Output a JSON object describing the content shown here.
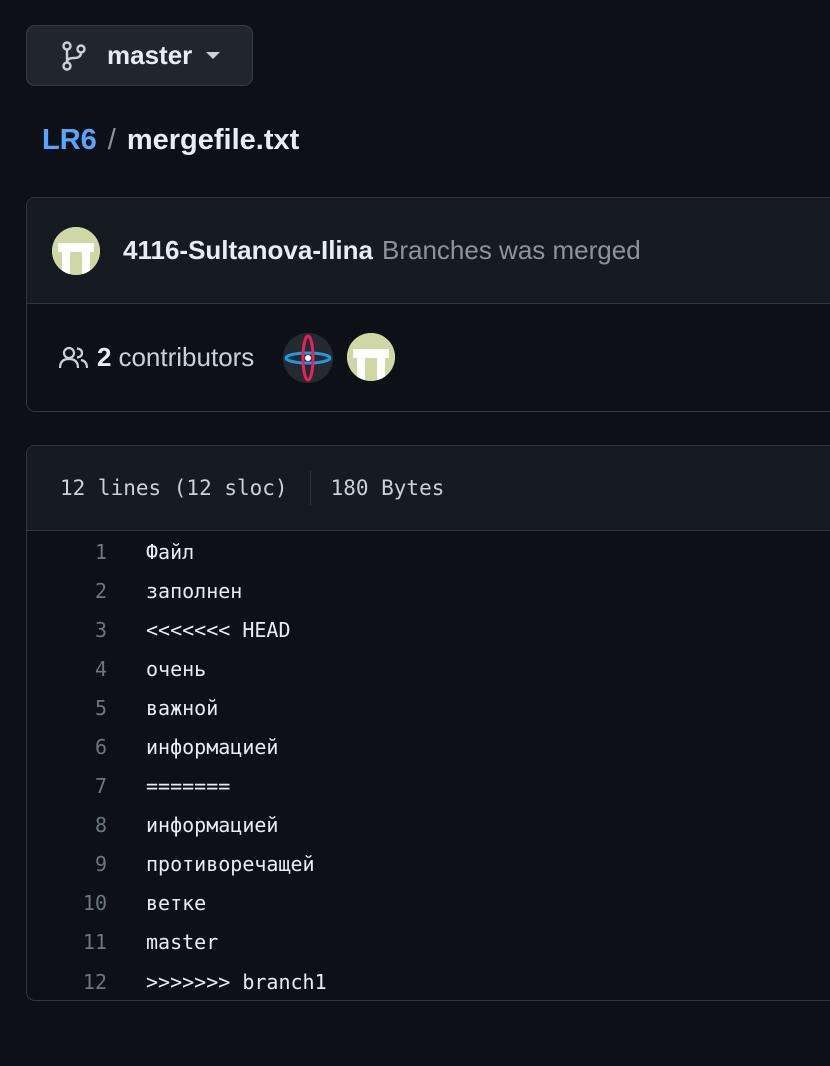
{
  "branch": {
    "name": "master",
    "icon": "git-branch-icon"
  },
  "breadcrumb": {
    "repo": "LR6",
    "separator": "/",
    "file": "mergefile.txt"
  },
  "commit": {
    "author": "4116-Sultanova-Ilina",
    "message": "Branches was merged"
  },
  "contributors": {
    "count": "2",
    "label": "contributors"
  },
  "file": {
    "lines": "12 lines (12 sloc)",
    "size": "180 Bytes"
  },
  "code": [
    {
      "n": "1",
      "text": "Файл"
    },
    {
      "n": "2",
      "text": "заполнен"
    },
    {
      "n": "3",
      "text": "<<<<<<< HEAD"
    },
    {
      "n": "4",
      "text": "очень"
    },
    {
      "n": "5",
      "text": "важной"
    },
    {
      "n": "6",
      "text": "информацией"
    },
    {
      "n": "7",
      "text": "======="
    },
    {
      "n": "8",
      "text": "информацией"
    },
    {
      "n": "9",
      "text": "противоречащей"
    },
    {
      "n": "10",
      "text": "ветке"
    },
    {
      "n": "11",
      "text": "master"
    },
    {
      "n": "12",
      "text": ">>>>>>> branch1"
    }
  ],
  "colors": {
    "background": "#0d1117",
    "link": "#58a6ff",
    "avatar": "#cfd8a5"
  }
}
